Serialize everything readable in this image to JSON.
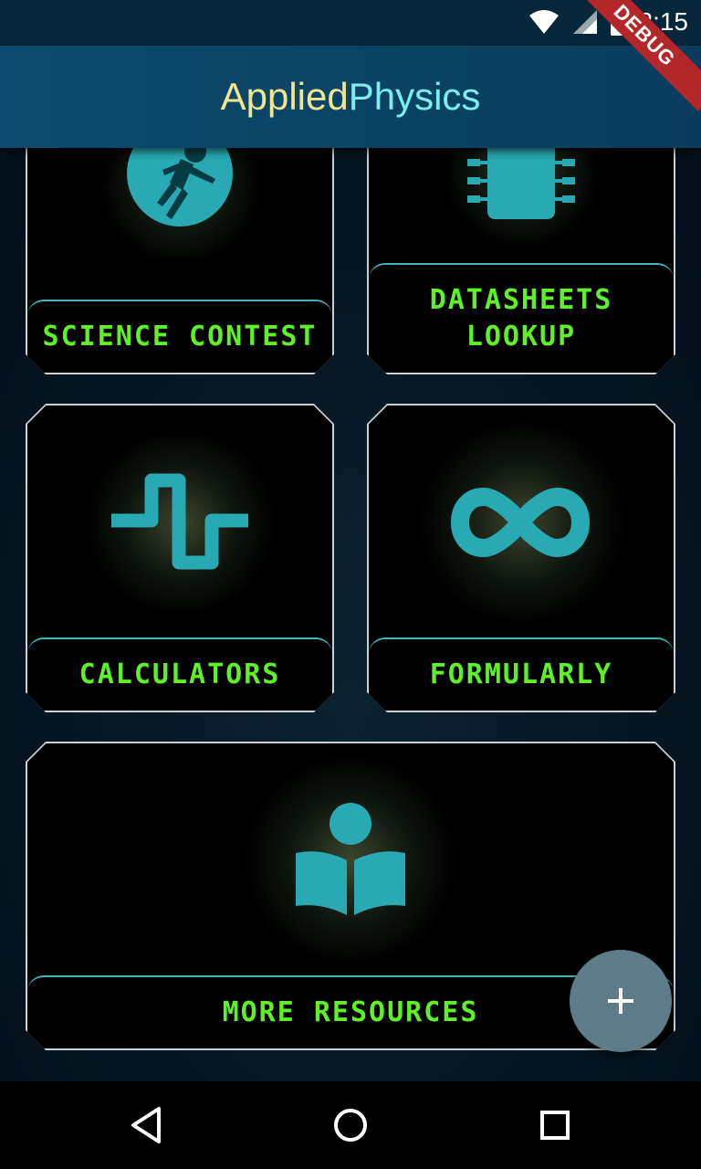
{
  "status_bar": {
    "time": "2:15",
    "icons": [
      "wifi-icon",
      "signal-icon",
      "battery-charging-icon"
    ],
    "debug_banner": "DEBUG"
  },
  "app_bar": {
    "title_part1": "Applied",
    "title_part2": "Physics",
    "title_colors": {
      "part1": "#f1e58e",
      "part2": "#7eecef"
    }
  },
  "cards": {
    "science_contest": {
      "label": "SCIENCE CONTEST",
      "icon": "astronaut-icon"
    },
    "datasheets": {
      "label_line1": "DATASHEETS",
      "label_line2": "LOOKUP",
      "icon": "chip-icon"
    },
    "calculators": {
      "label": "CALCULATORS",
      "icon": "square-wave-icon"
    },
    "formularly": {
      "label": "FORMULARLY",
      "icon": "infinity-icon"
    },
    "more_resources": {
      "label": "MORE RESOURCES",
      "icon": "reader-book-icon"
    }
  },
  "fab": {
    "icon": "plus-icon",
    "symbol": "+"
  },
  "nav_bar": {
    "icons": [
      "back-triangle-icon",
      "home-circle-icon",
      "recents-square-icon"
    ]
  },
  "colors": {
    "label_text": "#5ff02a",
    "icon_teal": "#29a9b3",
    "card_border": "#c8d0d4",
    "label_border": "#3fb7c3"
  }
}
